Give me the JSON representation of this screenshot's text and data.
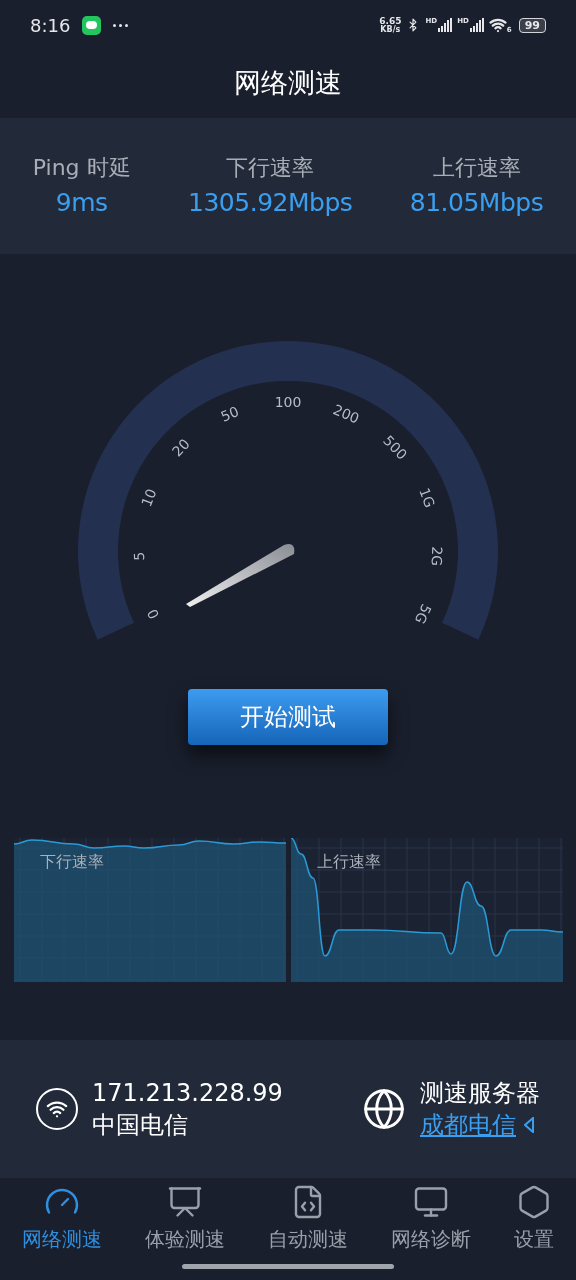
{
  "status_bar": {
    "time": "8:16",
    "speed_value": "6.65",
    "speed_unit": "KB/s",
    "sim_labels": [
      "HD",
      "HD"
    ],
    "wifi_badge": "6",
    "battery": "99"
  },
  "title": "网络测速",
  "stats": [
    {
      "label": "Ping 时延",
      "value": "9ms"
    },
    {
      "label": "下行速率",
      "value": "1305.92Mbps"
    },
    {
      "label": "上行速率",
      "value": "81.05Mbps"
    }
  ],
  "gauge": {
    "scale": [
      "0",
      "5",
      "10",
      "20",
      "50",
      "100",
      "200",
      "500",
      "1G",
      "2G",
      "5G"
    ]
  },
  "start_button": "开始测试",
  "graphs": [
    {
      "label": "下行速率"
    },
    {
      "label": "上行速率"
    }
  ],
  "connection": {
    "ip": "171.213.228.99",
    "carrier": "中国电信",
    "server_label": "测速服务器",
    "server": "成都电信"
  },
  "tabs": [
    {
      "label": "网络测速",
      "selected": true
    },
    {
      "label": "体验测速",
      "selected": false
    },
    {
      "label": "自动测速",
      "selected": false
    },
    {
      "label": "网络诊断",
      "selected": false
    },
    {
      "label": "设置",
      "selected": false
    }
  ]
}
